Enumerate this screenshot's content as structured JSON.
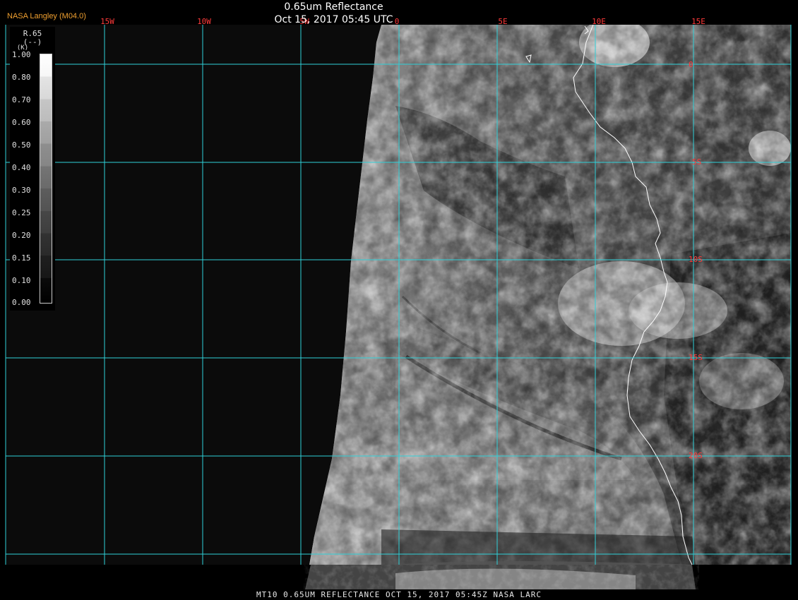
{
  "header": {
    "title": "0.65um Reflectance",
    "timestamp": "Oct 15, 2017 05:45 UTC",
    "brand": "NASA Langley (M04.0)"
  },
  "footer": {
    "caption": "MT10  0.65UM REFLECTANCE  OCT 15, 2017 05:45Z  NASA LARC"
  },
  "legend": {
    "title_line1": "R.65",
    "title_line2": "(--)",
    "title_line3": "(K)",
    "levels": [
      "1.00",
      "0.80",
      "0.70",
      "0.60",
      "0.50",
      "0.40",
      "0.30",
      "0.25",
      "0.20",
      "0.15",
      "0.10",
      "0.00"
    ]
  },
  "map": {
    "longitude_labels": [
      "15W",
      "10W",
      "5W",
      "0",
      "5E",
      "10E",
      "15E"
    ],
    "latitude_labels": [
      "0",
      "5S",
      "10S",
      "15S",
      "20S"
    ],
    "grid_color": "#2fd0d8",
    "tick_label_color": "#ff3a3a",
    "coastline_color": "#ffffff"
  }
}
